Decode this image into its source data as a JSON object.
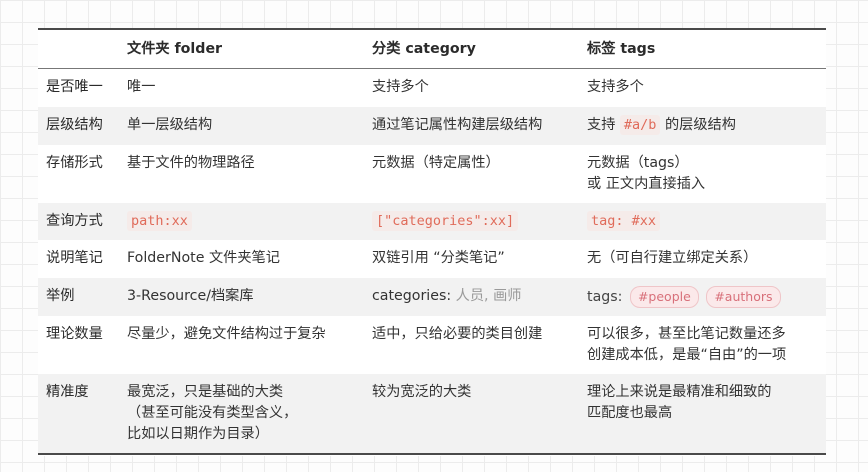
{
  "headers": [
    "",
    "文件夹 folder",
    "分类 category",
    "标签 tags"
  ],
  "rows": {
    "unique": {
      "label": "是否唯一",
      "folder": "唯一",
      "category": "支持多个",
      "tags": "支持多个"
    },
    "hierarchy": {
      "label": "层级结构",
      "folder": "单一层级结构",
      "category": "通过笔记属性构建层级结构",
      "tags_prefix": "支持",
      "tags_code": "#a/b",
      "tags_suffix": "的层级结构"
    },
    "storage": {
      "label": "存储形式",
      "folder": "基于文件的物理路径",
      "category": "元数据（特定属性）",
      "tags_line1": "元数据（tags）",
      "tags_line2": "或 正文内直接插入"
    },
    "query": {
      "label": "查询方式",
      "folder_code": "path:xx",
      "category_code": "[\"categories\":xx]",
      "tags_code": "tag: #xx"
    },
    "note": {
      "label": "说明笔记",
      "folder": "FolderNote 文件夹笔记",
      "category": "双链引用 “分类笔记”",
      "tags": "无（可自行建立绑定关系）"
    },
    "example": {
      "label": "举例",
      "folder": "3-Resource/档案库",
      "category_key": "categories:",
      "category_values": "人员, 画师",
      "tags_key": "tags:",
      "tag_items": [
        "#people",
        "#authors"
      ]
    },
    "quantity": {
      "label": "理论数量",
      "folder": "尽量少，避免文件结构过于复杂",
      "category": "适中，只给必要的类目创建",
      "tags_line1": "可以很多，甚至比笔记数量还多",
      "tags_line2": "创建成本低，是最“自由”的一项"
    },
    "precision": {
      "label": "精准度",
      "folder_line1": "最宽泛，只是基础的大类",
      "folder_line2": "（甚至可能没有类型含义，",
      "folder_line3": "比如以日期作为目录）",
      "category": "较为宽泛的大类",
      "tags_line1": "理论上来说是最精准和细致的",
      "tags_line2": "匹配度也最高"
    }
  }
}
